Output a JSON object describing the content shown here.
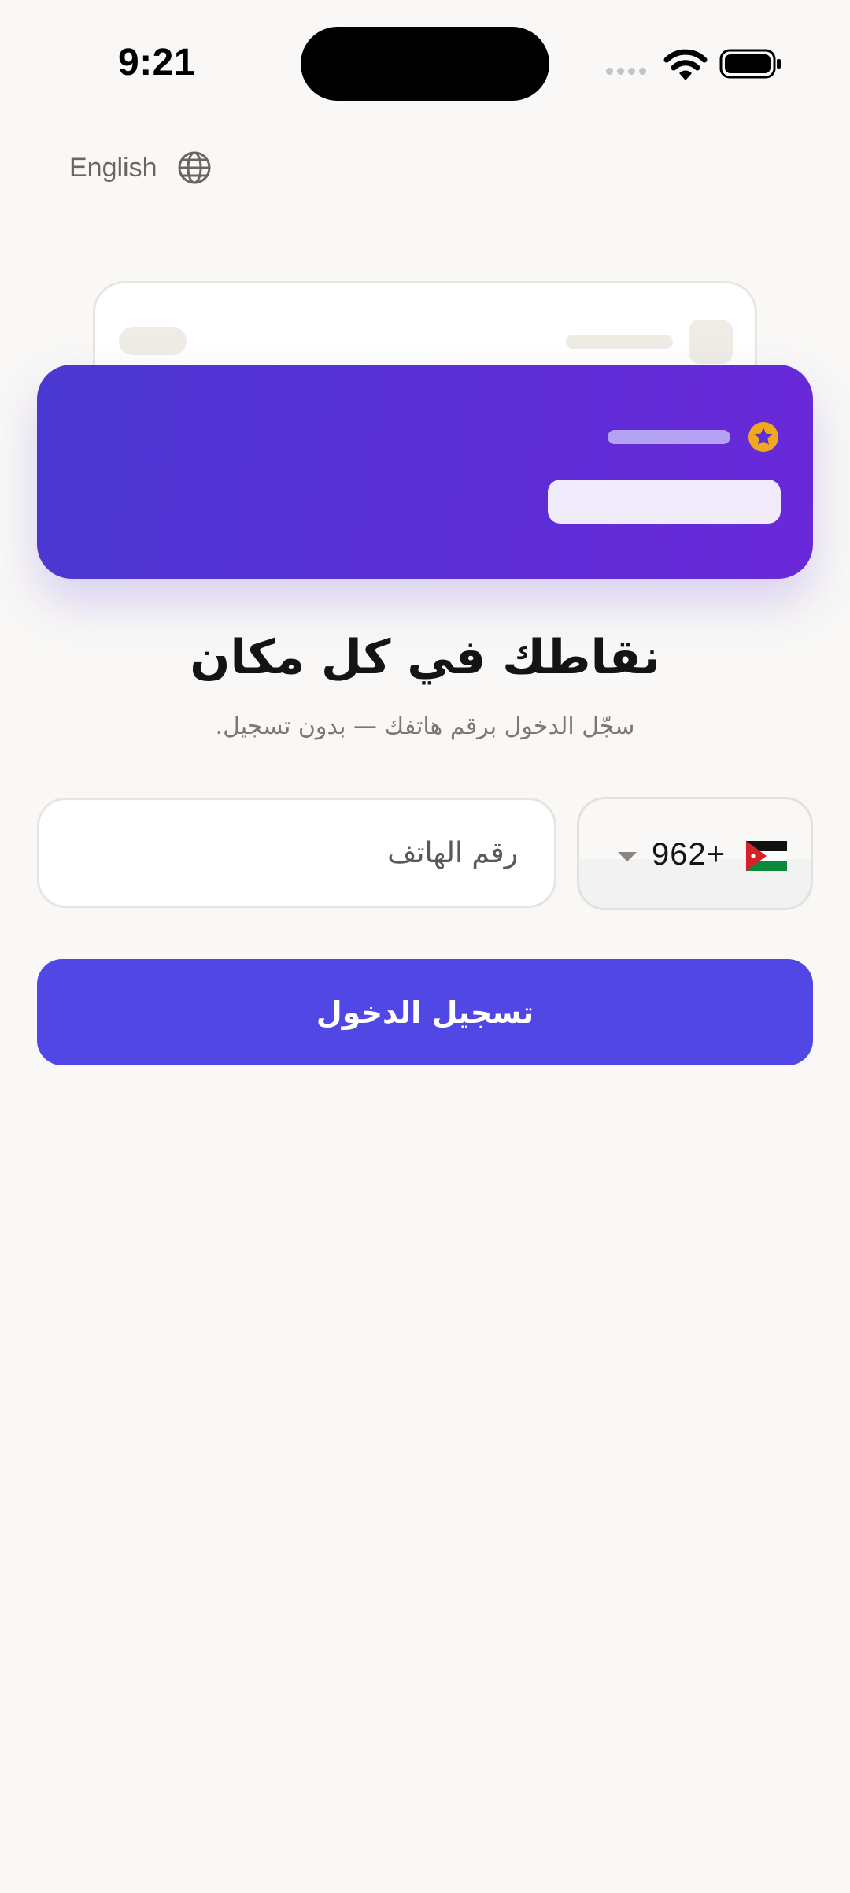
{
  "status_bar": {
    "time": "9:21"
  },
  "language_switch": {
    "label": "English",
    "icon": "globe-icon"
  },
  "hero": {
    "headline": "نقاطك في كل مكان",
    "subline": "سجّل الدخول برقم هاتفك — بدون تسجيل."
  },
  "phone": {
    "placeholder": "رقم الهاتف",
    "value": ""
  },
  "country": {
    "dial_code": "962+",
    "flag": "jordan-flag-icon"
  },
  "login": {
    "label": "تسجيل الدخول"
  },
  "colors": {
    "accent": "#5047e5",
    "card_gradient_start": "#4a38d2",
    "card_gradient_end": "#6a28d8",
    "star_badge": "#f0a81c",
    "background": "#f9f8f6"
  }
}
